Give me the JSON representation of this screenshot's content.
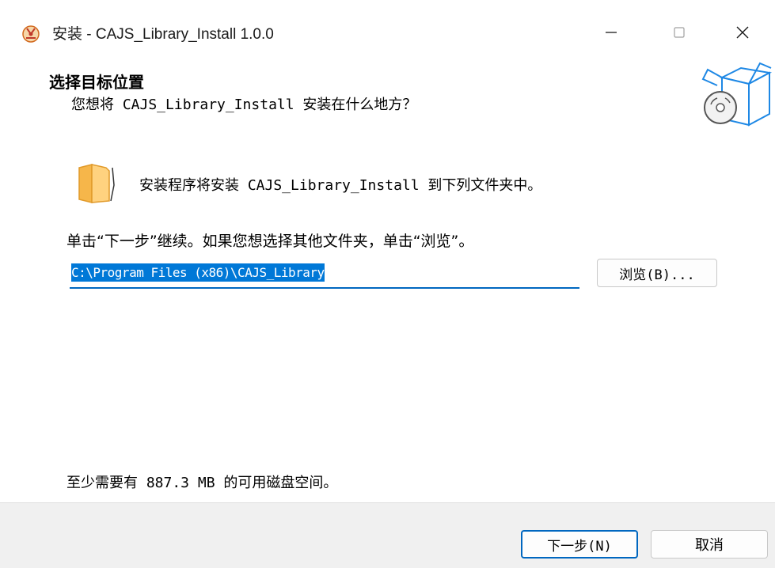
{
  "window": {
    "title": "安装 - CAJS_Library_Install 1.0.0",
    "controls": {
      "minimize_icon": "minimize-icon",
      "maximize_icon": "maximize-icon",
      "close_icon": "close-icon"
    }
  },
  "header": {
    "title": "选择目标位置",
    "subtitle": "您想将 CAJS_Library_Install 安装在什么地方？",
    "icon": "setup-box-icon"
  },
  "body": {
    "install_message": "安装程序将安装 CAJS_Library_Install 到下列文件夹中。",
    "continue_message": "单击“下一步”继续。如果您想选择其他文件夹，单击“浏览”。",
    "path_value": "C:\\Program Files (x86)\\CAJS_Library",
    "browse_label": "浏览(B)...",
    "disk_space": "至少需要有 887.3 MB 的可用磁盘空间。",
    "folder_icon": "folder-icon"
  },
  "footer": {
    "next_label": "下一步(N)",
    "cancel_label": "取消"
  },
  "colors": {
    "accent": "#0067c0",
    "selection": "#0078d7",
    "footer_bg": "#f0f0f0"
  }
}
